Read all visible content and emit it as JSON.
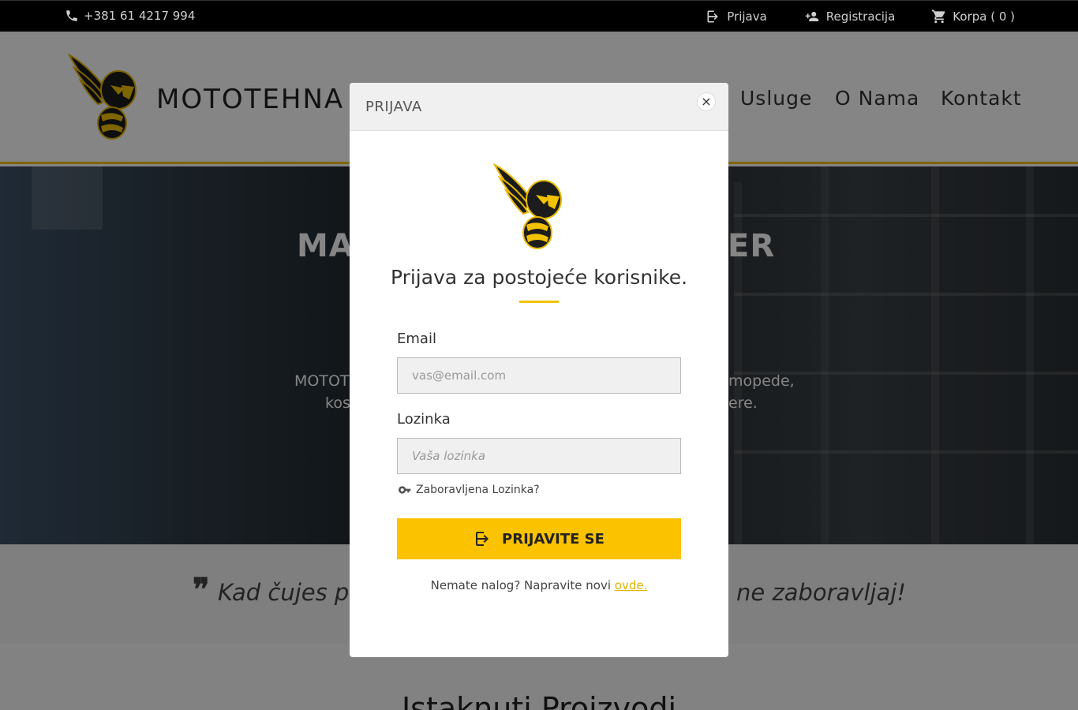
{
  "topbar": {
    "phone": "+381 61 4217 994",
    "login": "Prijava",
    "register": "Registracija",
    "cart": "Korpa ( 0 )"
  },
  "header": {
    "brand": "MOTOTEHNA",
    "nav": [
      "Usluge",
      "O Nama",
      "Kontakt"
    ]
  },
  "hero": {
    "title_left": "MA",
    "title_right": "ER",
    "sub_line1_left": "MOTOT",
    "sub_line1_right": "mopede,",
    "sub_line2_left": "kos",
    "sub_line2_right": "ere."
  },
  "quote": {
    "left": "Kad čujes po",
    "right": "ne zaboravljaj!"
  },
  "featured": {
    "heading": "Istaknuti Proizvodi"
  },
  "modal": {
    "title": "PRIJAVA",
    "close": "×",
    "heading": "Prijava za postojeće korisnike.",
    "email_label": "Email",
    "email_placeholder": "vas@email.com",
    "password_label": "Lozinka",
    "password_placeholder": "Vaša lozinka",
    "forgot": "Zaboravljena Lozinka?",
    "submit": "PRIJAVITE SE",
    "register_text": "Nemate nalog? Napravite novi",
    "register_link": "ovde",
    "register_end": "."
  },
  "colors": {
    "accent": "#fbc200",
    "topbar": "#000000"
  }
}
